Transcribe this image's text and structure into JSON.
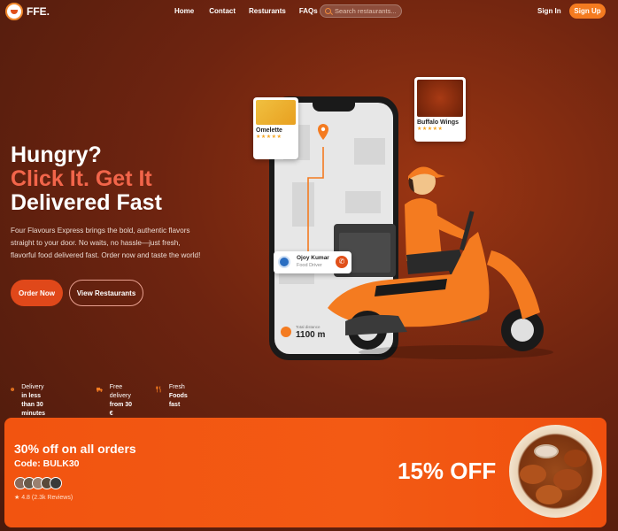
{
  "brand": {
    "name": "FFE."
  },
  "nav": {
    "links": [
      "Home",
      "Contact",
      "Resturants",
      "FAQs"
    ],
    "search_placeholder": "Search restaurants...",
    "sign_in": "Sign In",
    "sign_up": "Sign Up"
  },
  "hero": {
    "line1": "Hungry?",
    "line2": "Click It. Get It",
    "line3": "Delivered Fast",
    "description": "Four Flavours Express brings the bold, authentic flavors straight to your door. No waits, no hassle—just fresh, flavorful food delivered fast. Order now and taste the world!",
    "order_button": "Order Now",
    "view_button": "View Restaurants"
  },
  "features": [
    {
      "icon": "clock-icon",
      "line1": "Delivery",
      "line2": "in less than 30 minutes"
    },
    {
      "icon": "truck-icon",
      "line1": "Free delivery",
      "line2": "from 30 €"
    },
    {
      "icon": "utensils-icon",
      "line1": "Fresh",
      "line2": "Foods fast"
    }
  ],
  "phone": {
    "dish1": {
      "name": "Omelette",
      "stars": "★★★★★"
    },
    "dish2": {
      "name": "Buffalo Wings",
      "stars": "★★★★★"
    },
    "driver": {
      "name": "Ojoy Kumar",
      "role": "Food Driver"
    },
    "distance": {
      "label": "Total distance",
      "value": "1100 m"
    }
  },
  "promo": {
    "title": "30% off on all orders",
    "code": "Code: BULK30",
    "rating": "★ 4.8  (2.3k Reviews)",
    "off": "15% OFF"
  },
  "colors": {
    "accent": "#f47b20",
    "promo_bg": "#f25410",
    "hero_accent": "#f2654a"
  }
}
